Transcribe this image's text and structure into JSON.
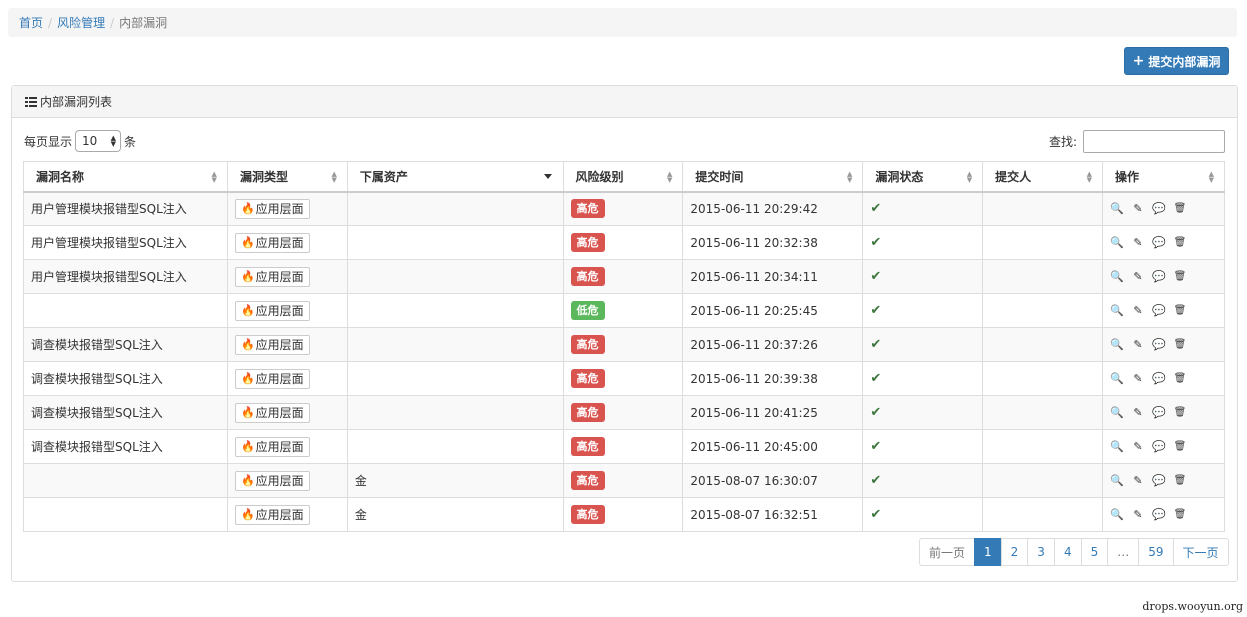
{
  "breadcrumb": {
    "home": "首页",
    "section": "风险管理",
    "current": "内部漏洞",
    "separator": "/"
  },
  "toolbar": {
    "submit_label": "提交内部漏洞",
    "submit_icon": "plus-icon"
  },
  "panel": {
    "title": "内部漏洞列表",
    "icon": "list-icon"
  },
  "length_control": {
    "prefix": "每页显示",
    "value": "10",
    "suffix": "条"
  },
  "search": {
    "label": "查找:",
    "value": ""
  },
  "table": {
    "headers": [
      "漏洞名称",
      "漏洞类型",
      "下属资产",
      "风险级别",
      "提交时间",
      "漏洞状态",
      "提交人",
      "操作"
    ],
    "rows": [
      {
        "name": "用户管理模块报错型SQL注入",
        "type": "应用层面",
        "asset": "",
        "risk": "高危",
        "risk_level": "high",
        "time": "2015-06-11 20:29:42",
        "status": "✔",
        "submitter": ""
      },
      {
        "name": "用户管理模块报错型SQL注入",
        "type": "应用层面",
        "asset": "",
        "risk": "高危",
        "risk_level": "high",
        "time": "2015-06-11 20:32:38",
        "status": "✔",
        "submitter": ""
      },
      {
        "name": "用户管理模块报错型SQL注入",
        "type": "应用层面",
        "asset": "",
        "risk": "高危",
        "risk_level": "high",
        "time": "2015-06-11 20:34:11",
        "status": "✔",
        "submitter": ""
      },
      {
        "name": "",
        "type": "应用层面",
        "asset": "",
        "risk": "低危",
        "risk_level": "low",
        "time": "2015-06-11 20:25:45",
        "status": "✔",
        "submitter": ""
      },
      {
        "name": "调查模块报错型SQL注入",
        "type": "应用层面",
        "asset": "",
        "risk": "高危",
        "risk_level": "high",
        "time": "2015-06-11 20:37:26",
        "status": "✔",
        "submitter": ""
      },
      {
        "name": "调查模块报错型SQL注入",
        "type": "应用层面",
        "asset": "",
        "risk": "高危",
        "risk_level": "high",
        "time": "2015-06-11 20:39:38",
        "status": "✔",
        "submitter": ""
      },
      {
        "name": "调查模块报错型SQL注入",
        "type": "应用层面",
        "asset": "",
        "risk": "高危",
        "risk_level": "high",
        "time": "2015-06-11 20:41:25",
        "status": "✔",
        "submitter": ""
      },
      {
        "name": "调查模块报错型SQL注入",
        "type": "应用层面",
        "asset": "",
        "risk": "高危",
        "risk_level": "high",
        "time": "2015-06-11 20:45:00",
        "status": "✔",
        "submitter": ""
      },
      {
        "name": "",
        "type": "应用层面",
        "asset": "金",
        "risk": "高危",
        "risk_level": "high",
        "time": "2015-08-07 16:30:07",
        "status": "✔",
        "submitter": ""
      },
      {
        "name": "",
        "type": "应用层面",
        "asset": "金",
        "risk": "高危",
        "risk_level": "high",
        "time": "2015-08-07 16:32:51",
        "status": "✔",
        "submitter": ""
      }
    ],
    "actions": [
      {
        "icon": "search-icon",
        "glyph": "🔍"
      },
      {
        "icon": "edit-icon",
        "glyph": "✎"
      },
      {
        "icon": "comment-icon",
        "glyph": "💬"
      },
      {
        "icon": "trash-icon",
        "glyph": "🗑"
      }
    ],
    "type_icon": "fire-icon",
    "type_glyph": "🔥"
  },
  "pagination": {
    "prev": "前一页",
    "pages": [
      "1",
      "2",
      "3",
      "4",
      "5"
    ],
    "ellipsis": "…",
    "last": "59",
    "next": "下一页",
    "current": "1"
  },
  "watermark": "drops.wooyun.org",
  "colors": {
    "primary": "#337ab7",
    "danger": "#d9534f",
    "success": "#5cb85c"
  }
}
